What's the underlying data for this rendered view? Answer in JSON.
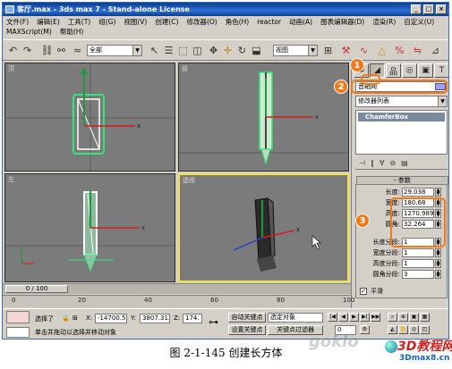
{
  "window": {
    "title": "客厅.max - 3ds max 7 - Stand-alone License",
    "min": "_",
    "max": "□",
    "close": "×"
  },
  "menu": {
    "row1": [
      "文件(F)",
      "编辑(E)",
      "工具(T)",
      "组(G)",
      "视图(V)",
      "创建(C)",
      "修改器(O)",
      "角色(H)",
      "reactor",
      "动画(A)",
      "图表编辑器(D)",
      "渲染(R)",
      "自定义(U)"
    ],
    "row2": [
      "MAXScript(M)",
      "帮助(H)"
    ]
  },
  "toolbar": {
    "selection_filter": "全部",
    "ref_coord": "视图"
  },
  "viewports": {
    "top": "顶",
    "front": "前",
    "left": "左",
    "perspective": "透视"
  },
  "command_panel": {
    "object_name": "音箱网",
    "modifier_list": "修改器列表",
    "stack_item": "ChamferBox",
    "rollout_title": "参数",
    "params": [
      {
        "label": "长度:",
        "value": "29.038"
      },
      {
        "label": "宽度:",
        "value": "180.68"
      },
      {
        "label": "高度:",
        "value": "1270.989"
      },
      {
        "label": "圆角:",
        "value": "32.264"
      }
    ],
    "segments": [
      {
        "label": "长度分段:",
        "value": "1"
      },
      {
        "label": "宽度分段:",
        "value": "1"
      },
      {
        "label": "高度分段:",
        "value": "1"
      },
      {
        "label": "圆角分段:",
        "value": "3"
      }
    ],
    "smooth_label": "平滑"
  },
  "callouts": [
    "1",
    "2",
    "3"
  ],
  "timeline": {
    "slider": "0 / 100",
    "ticks": [
      "0",
      "20",
      "40",
      "60",
      "80",
      "100"
    ]
  },
  "status": {
    "selected": "选择了",
    "x_label": "X:",
    "x_value": "-14700.53",
    "y_label": "Y:",
    "y_value": "3807.313",
    "z_label": "Z:",
    "z_value": "174.",
    "autokey": "自动关键点",
    "selected_obj": "选定对象",
    "setkey": "设置关键点",
    "key_filters": "关键点过滤器",
    "prompt": "单击并拖动以选择并移动对象",
    "frame": "0"
  },
  "caption": "图 2-1-145   创建长方体",
  "watermark": "goklo",
  "site": {
    "name": "3D教程网",
    "url": "3Dmax8.cn"
  },
  "colors": {
    "accent_orange": "#f07a1a",
    "viewport_bg": "#7b7b7b",
    "active_border": "#f0e44a",
    "title_blue": "#0a3d91"
  }
}
